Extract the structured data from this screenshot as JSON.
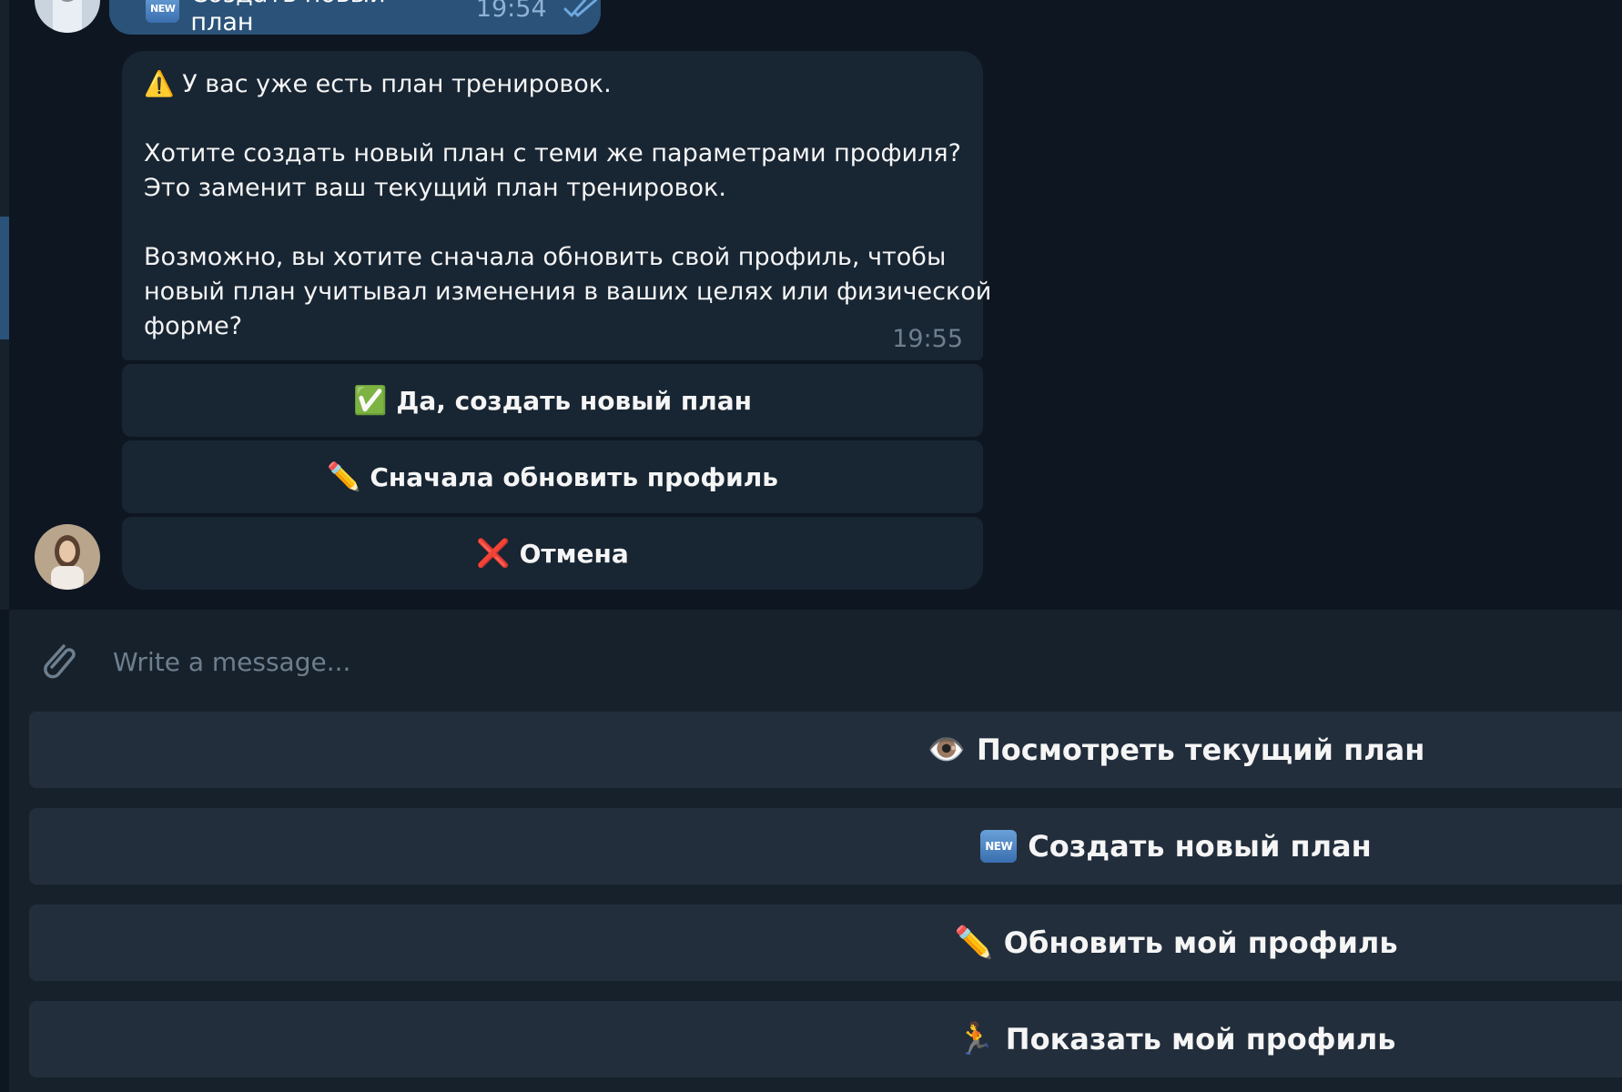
{
  "colors": {
    "chat_background": "#0e1621",
    "panel_background": "#17212b",
    "bubble_background": "#182533",
    "outgoing_bubble": "#2b5278",
    "keyboard_button": "#232e3c",
    "muted_text": "#6d7f8f"
  },
  "outgoing_message": {
    "badge": "NEW",
    "text": "Создать новый план",
    "time": "19:54",
    "status_icon": "double-check-icon"
  },
  "bot_message": {
    "warning_emoji": "⚠️",
    "line1": "У вас уже есть план тренировок.",
    "line2": "Хотите создать новый план с теми же параметрами профиля?",
    "line3": "Это заменит ваш текущий план тренировок.",
    "line4": "Возможно, вы хотите сначала обновить свой профиль, чтобы",
    "line5": "новый план учитывал изменения в ваших целях или физической",
    "line6": "форме?",
    "time": "19:55"
  },
  "inline_buttons": [
    {
      "emoji": "✅",
      "label": "Да, создать новый план"
    },
    {
      "emoji": "✏️",
      "label": "Сначала обновить профиль"
    },
    {
      "emoji": "❌",
      "label": "Отмена"
    }
  ],
  "composer": {
    "placeholder": "Write a message...",
    "attach_icon": "paperclip-icon"
  },
  "keyboard_buttons": [
    {
      "emoji": "👁️",
      "label": "Посмотреть текущий план"
    },
    {
      "badge": "NEW",
      "label": "Создать новый план"
    },
    {
      "emoji": "✏️",
      "label": "Обновить мой профиль"
    },
    {
      "emoji": "🏃",
      "label": "Показать мой профиль"
    }
  ]
}
